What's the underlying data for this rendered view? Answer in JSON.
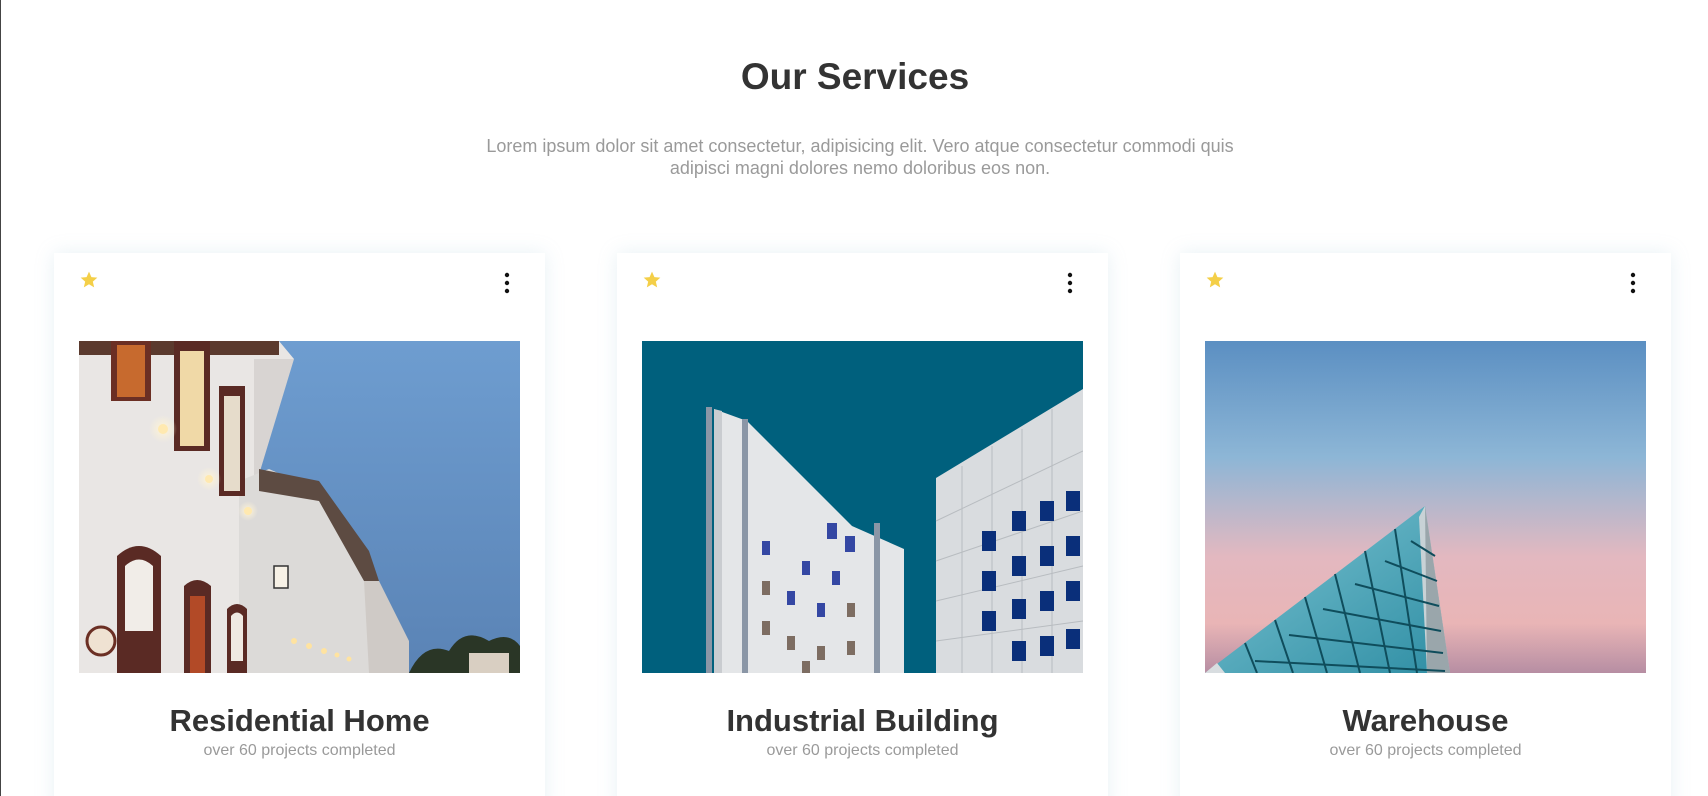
{
  "section": {
    "title": "Our Services",
    "description": "Lorem ipsum dolor sit amet consectetur, adipisicing elit. Vero atque consectetur commodi quis adipisci magni dolores nemo doloribus eos non."
  },
  "colors": {
    "star": "#f4cf48",
    "heading": "#333333",
    "muted": "#9a9a9a"
  },
  "cards": [
    {
      "title": "Residential Home",
      "subtitle": "over 60 projects completed",
      "star_icon": "star-icon",
      "menu_icon": "more-vertical-icon"
    },
    {
      "title": "Industrial Building",
      "subtitle": "over 60 projects completed",
      "star_icon": "star-icon",
      "menu_icon": "more-vertical-icon"
    },
    {
      "title": "Warehouse",
      "subtitle": "over 60 projects completed",
      "star_icon": "star-icon",
      "menu_icon": "more-vertical-icon"
    }
  ]
}
